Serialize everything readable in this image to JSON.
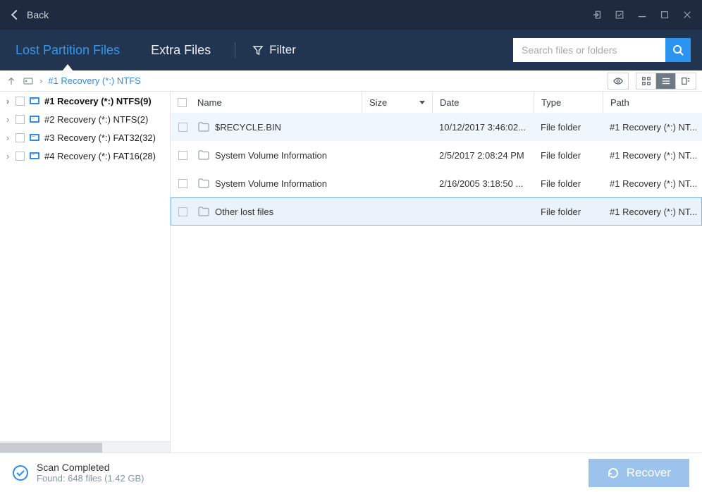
{
  "titlebar": {
    "back_label": "Back"
  },
  "tabs": {
    "lost_partition": "Lost Partition Files",
    "extra_files": "Extra Files",
    "filter": "Filter"
  },
  "search": {
    "placeholder": "Search files or folders"
  },
  "breadcrumb": {
    "path": "#1 Recovery (*:) NTFS"
  },
  "sidebar": {
    "items": [
      {
        "label": "#1 Recovery (*:) NTFS(9)",
        "selected": true
      },
      {
        "label": "#2 Recovery (*:) NTFS(2)",
        "selected": false
      },
      {
        "label": "#3 Recovery (*:) FAT32(32)",
        "selected": false
      },
      {
        "label": "#4 Recovery (*:) FAT16(28)",
        "selected": false
      }
    ]
  },
  "table": {
    "headers": {
      "name": "Name",
      "size": "Size",
      "date": "Date",
      "type": "Type",
      "path": "Path"
    },
    "rows": [
      {
        "name": "$RECYCLE.BIN",
        "size": "",
        "date": "10/12/2017 3:46:02...",
        "type": "File folder",
        "path": "#1 Recovery (*:) NT...",
        "alt": true
      },
      {
        "name": "System Volume Information",
        "size": "",
        "date": "2/5/2017 2:08:24 PM",
        "type": "File folder",
        "path": "#1 Recovery (*:) NT...",
        "alt": false
      },
      {
        "name": "System Volume Information",
        "size": "",
        "date": "2/16/2005 3:18:50 ...",
        "type": "File folder",
        "path": "#1 Recovery (*:) NT...",
        "alt": false
      },
      {
        "name": "Other lost files",
        "size": "",
        "date": "",
        "type": "File folder",
        "path": "#1 Recovery (*:) NT...",
        "alt": true,
        "selected": true
      }
    ]
  },
  "footer": {
    "status_line1": "Scan Completed",
    "status_line2": "Found: 648 files (1.42 GB)",
    "recover_label": "Recover"
  }
}
